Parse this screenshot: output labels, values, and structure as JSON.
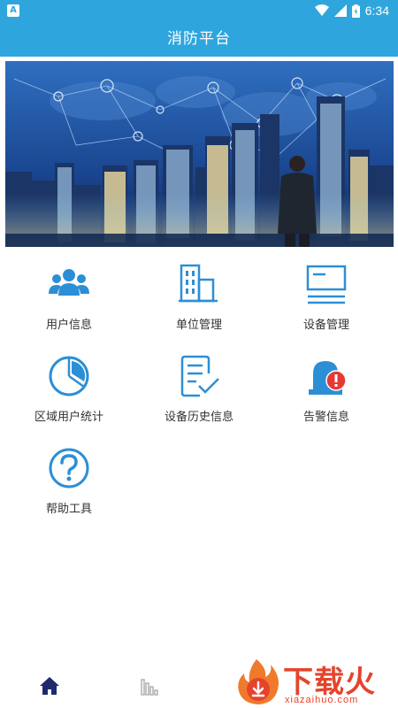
{
  "status_bar": {
    "notification_icon": "A",
    "time": "6:34",
    "icons": [
      "wifi-icon",
      "signal-icon",
      "battery-icon"
    ]
  },
  "header": {
    "title": "消防平台"
  },
  "banner": {
    "image": "city-skyline-businessman"
  },
  "menu": {
    "items": [
      {
        "label": "用户信息",
        "icon": "users-icon"
      },
      {
        "label": "单位管理",
        "icon": "building-icon"
      },
      {
        "label": "设备管理",
        "icon": "device-icon"
      },
      {
        "label": "区域用户统计",
        "icon": "pie-chart-icon"
      },
      {
        "label": "设备历史信息",
        "icon": "history-document-icon"
      },
      {
        "label": "告警信息",
        "icon": "alarm-icon"
      },
      {
        "label": "帮助工具",
        "icon": "help-icon"
      }
    ]
  },
  "bottom_nav": {
    "items": [
      {
        "icon": "home-icon",
        "active": true
      },
      {
        "icon": "stats-icon",
        "active": false
      }
    ]
  },
  "watermark": {
    "title": "下载火",
    "subtitle": "xiazaihuo.com"
  },
  "colors": {
    "primary": "#2ea6dd",
    "icon_blue": "#2c8fd6",
    "alarm_red": "#e53935",
    "nav_active": "#1f2a6e",
    "nav_inactive": "#b0b0b0"
  }
}
